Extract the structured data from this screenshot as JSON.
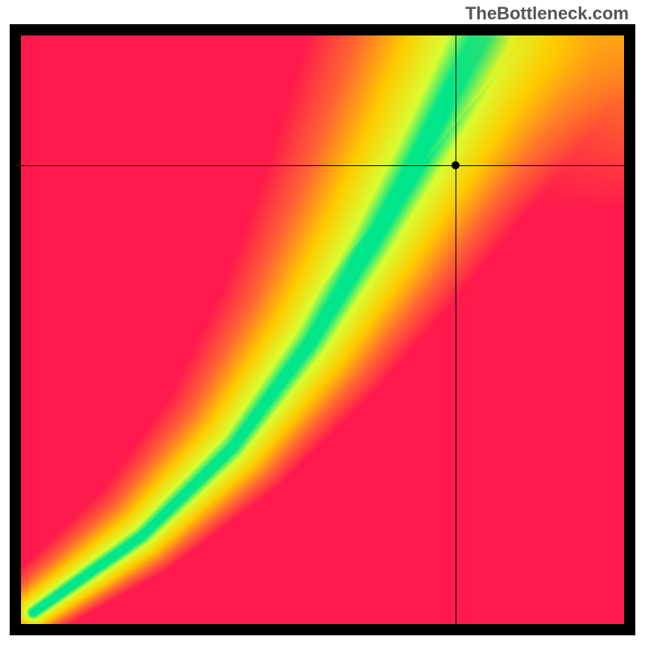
{
  "watermark": "TheBottleneck.com",
  "chart_data": {
    "type": "heatmap",
    "title": "",
    "xlabel": "",
    "ylabel": "",
    "xlim": [
      0,
      100
    ],
    "ylim": [
      0,
      100
    ],
    "color_scale": [
      "#ff1a4d",
      "#ff6633",
      "#ffcc00",
      "#d9ff33",
      "#00e68a"
    ],
    "description": "2D gradient heatmap with a narrow S-shaped green ridge running from bottom-left to upper-right indicating optimal match; red regions at upper-left and lower-right indicate severe bottleneck; yellow/orange transitional band surrounds the green ridge.",
    "green_ridge_path": [
      {
        "x": 2,
        "y": 2
      },
      {
        "x": 20,
        "y": 15
      },
      {
        "x": 35,
        "y": 30
      },
      {
        "x": 48,
        "y": 48
      },
      {
        "x": 58,
        "y": 65
      },
      {
        "x": 66,
        "y": 80
      },
      {
        "x": 72,
        "y": 92
      },
      {
        "x": 76,
        "y": 100
      }
    ],
    "crosshair": {
      "x": 72,
      "y": 78
    },
    "marker": {
      "x": 72,
      "y": 78
    }
  }
}
